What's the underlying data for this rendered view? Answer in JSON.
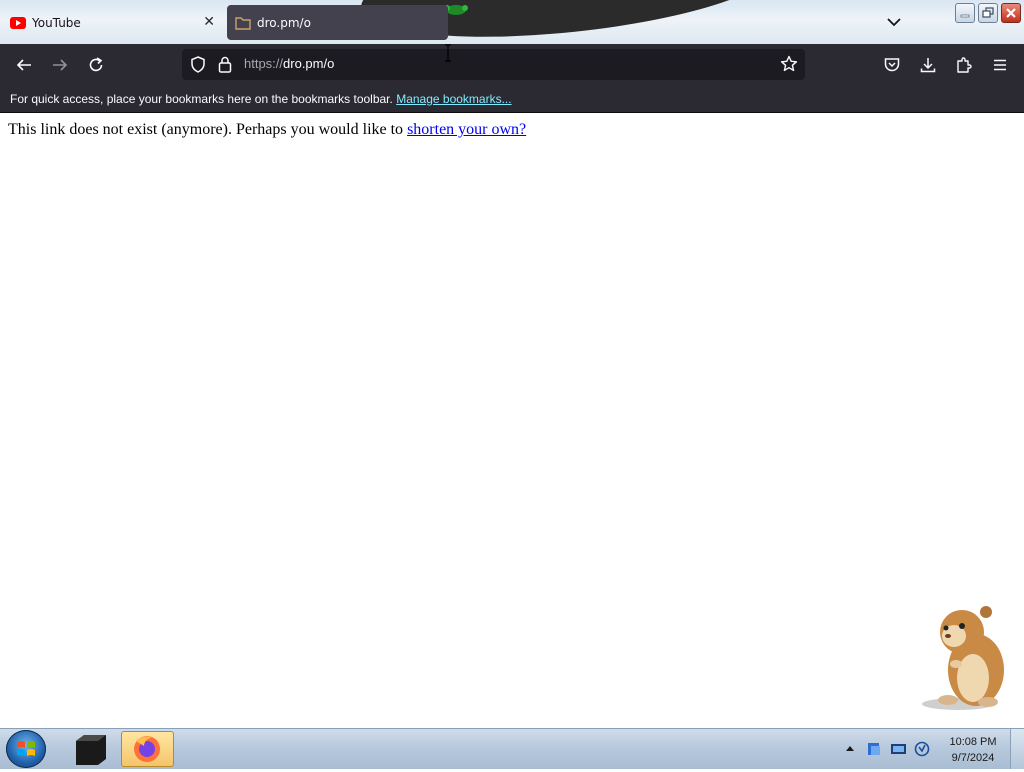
{
  "tabs": [
    {
      "title": "YouTube",
      "favicon": "youtube-icon",
      "active": false
    },
    {
      "title": "dro.pm/o",
      "favicon": "folder-icon",
      "active": true
    }
  ],
  "navbar": {
    "url_scheme": "https://",
    "url_rest": "dro.pm/o"
  },
  "bookmarks_bar": {
    "message": "For quick access, place your bookmarks here on the bookmarks toolbar.",
    "manage_link": "Manage bookmarks..."
  },
  "page": {
    "text": "This link does not exist (anymore). Perhaps you would like to",
    "link_text": "shorten your own?"
  },
  "taskbar": {
    "time": "10:08 PM",
    "date": "9/7/2024"
  },
  "colors": {
    "toolbar_bg": "#2b2a33",
    "urlbar_bg": "#1c1b22",
    "link": "#0000ee",
    "bookmark_link": "#80ebff"
  }
}
